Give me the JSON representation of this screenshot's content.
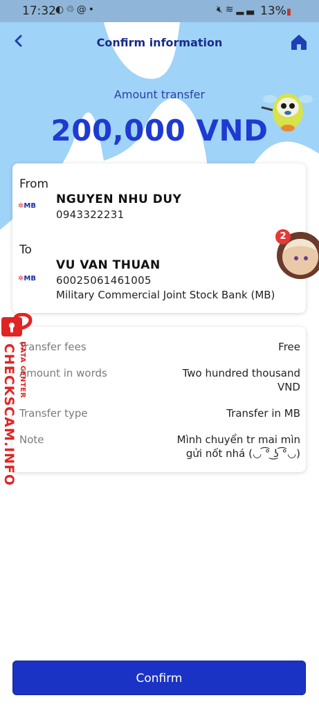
{
  "status_bar": {
    "time": "17:32",
    "notif_icons": [
      "messenger-icon",
      "recycle-icon",
      "at-icon"
    ],
    "dot": "•",
    "battery": "13%",
    "right_icons": [
      "mute-icon",
      "wifi-icon",
      "signal-icon"
    ]
  },
  "header": {
    "title": "Confirm information",
    "back_icon": "back-chevron-icon",
    "home_icon": "home-icon"
  },
  "transfer": {
    "amount_label": "Amount transfer",
    "amount": "200,000 VND"
  },
  "from": {
    "label": "From",
    "bank_logo": "MB",
    "name": "NGUYEN NHU DUY",
    "account": "0943322231"
  },
  "to": {
    "label": "To",
    "bank_logo": "MB",
    "name": "VU VAN THUAN",
    "account": "60025061461005",
    "bank_name": "Military Commercial Joint Stock Bank (MB)"
  },
  "details": {
    "fees_label": "Transfer fees",
    "fees_value": "Free",
    "words_label": "Amount in words",
    "words_value_line1": "Two hundred thousand",
    "words_value_line2": "VND",
    "type_label": "Transfer type",
    "type_value": "Transfer in MB",
    "note_label": "Note",
    "note_value_line1": "Mình chuyển tr mai mìn",
    "note_value_line2": "gửi nốt nhá (◡ ͡° ͜ʖ ͡°◡)"
  },
  "chat_head": {
    "badge_count": "2"
  },
  "watermark": {
    "main": "CHECKSCAM.INFO",
    "sub": "DATA CENTER"
  },
  "actions": {
    "confirm_label": "Confirm"
  },
  "colors": {
    "primary": "#1b33c4",
    "background_swoosh": "#9fd3f7",
    "watermark": "#e02424"
  }
}
